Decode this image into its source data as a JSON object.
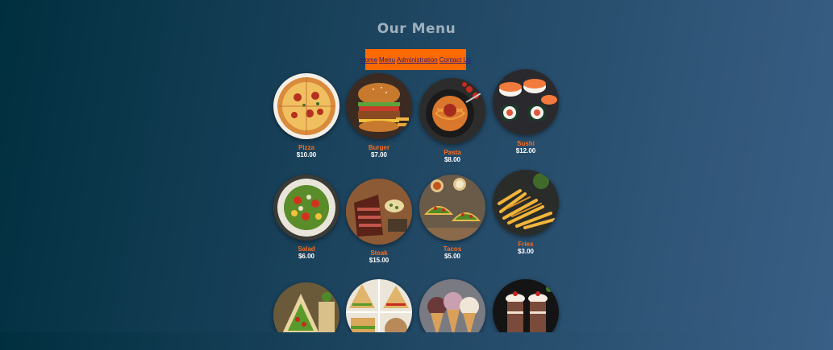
{
  "page": {
    "title": "Our Menu"
  },
  "nav": {
    "links": [
      "Home",
      "Menu",
      "Administration",
      "Contact Us"
    ]
  },
  "menu": {
    "items": [
      {
        "name": "Pizza",
        "price": "$10.00",
        "image": "pizza-image"
      },
      {
        "name": "Burger",
        "price": "$7.00",
        "image": "burger-image"
      },
      {
        "name": "Pasta",
        "price": "$8.00",
        "image": "pasta-image"
      },
      {
        "name": "Sushi",
        "price": "$12.00",
        "image": "sushi-image"
      },
      {
        "name": "Salad",
        "price": "$6.00",
        "image": "salad-image"
      },
      {
        "name": "Steak",
        "price": "$15.00",
        "image": "steak-image"
      },
      {
        "name": "Tacos",
        "price": "$5.00",
        "image": "tacos-image"
      },
      {
        "name": "Fries",
        "price": "$3.00",
        "image": "fries-image"
      },
      {
        "name": "",
        "price": "",
        "image": "wrap-image"
      },
      {
        "name": "",
        "price": "",
        "image": "sandwich-image"
      },
      {
        "name": "",
        "price": "",
        "image": "ice-cream-image"
      },
      {
        "name": "",
        "price": "",
        "image": "milkshake-image"
      }
    ]
  },
  "colors": {
    "accent": "#ff6a00",
    "item_name": "#ff6a1a",
    "price": "#ffffff",
    "title": "#9fb0bd",
    "link": "#2a1a7a"
  }
}
